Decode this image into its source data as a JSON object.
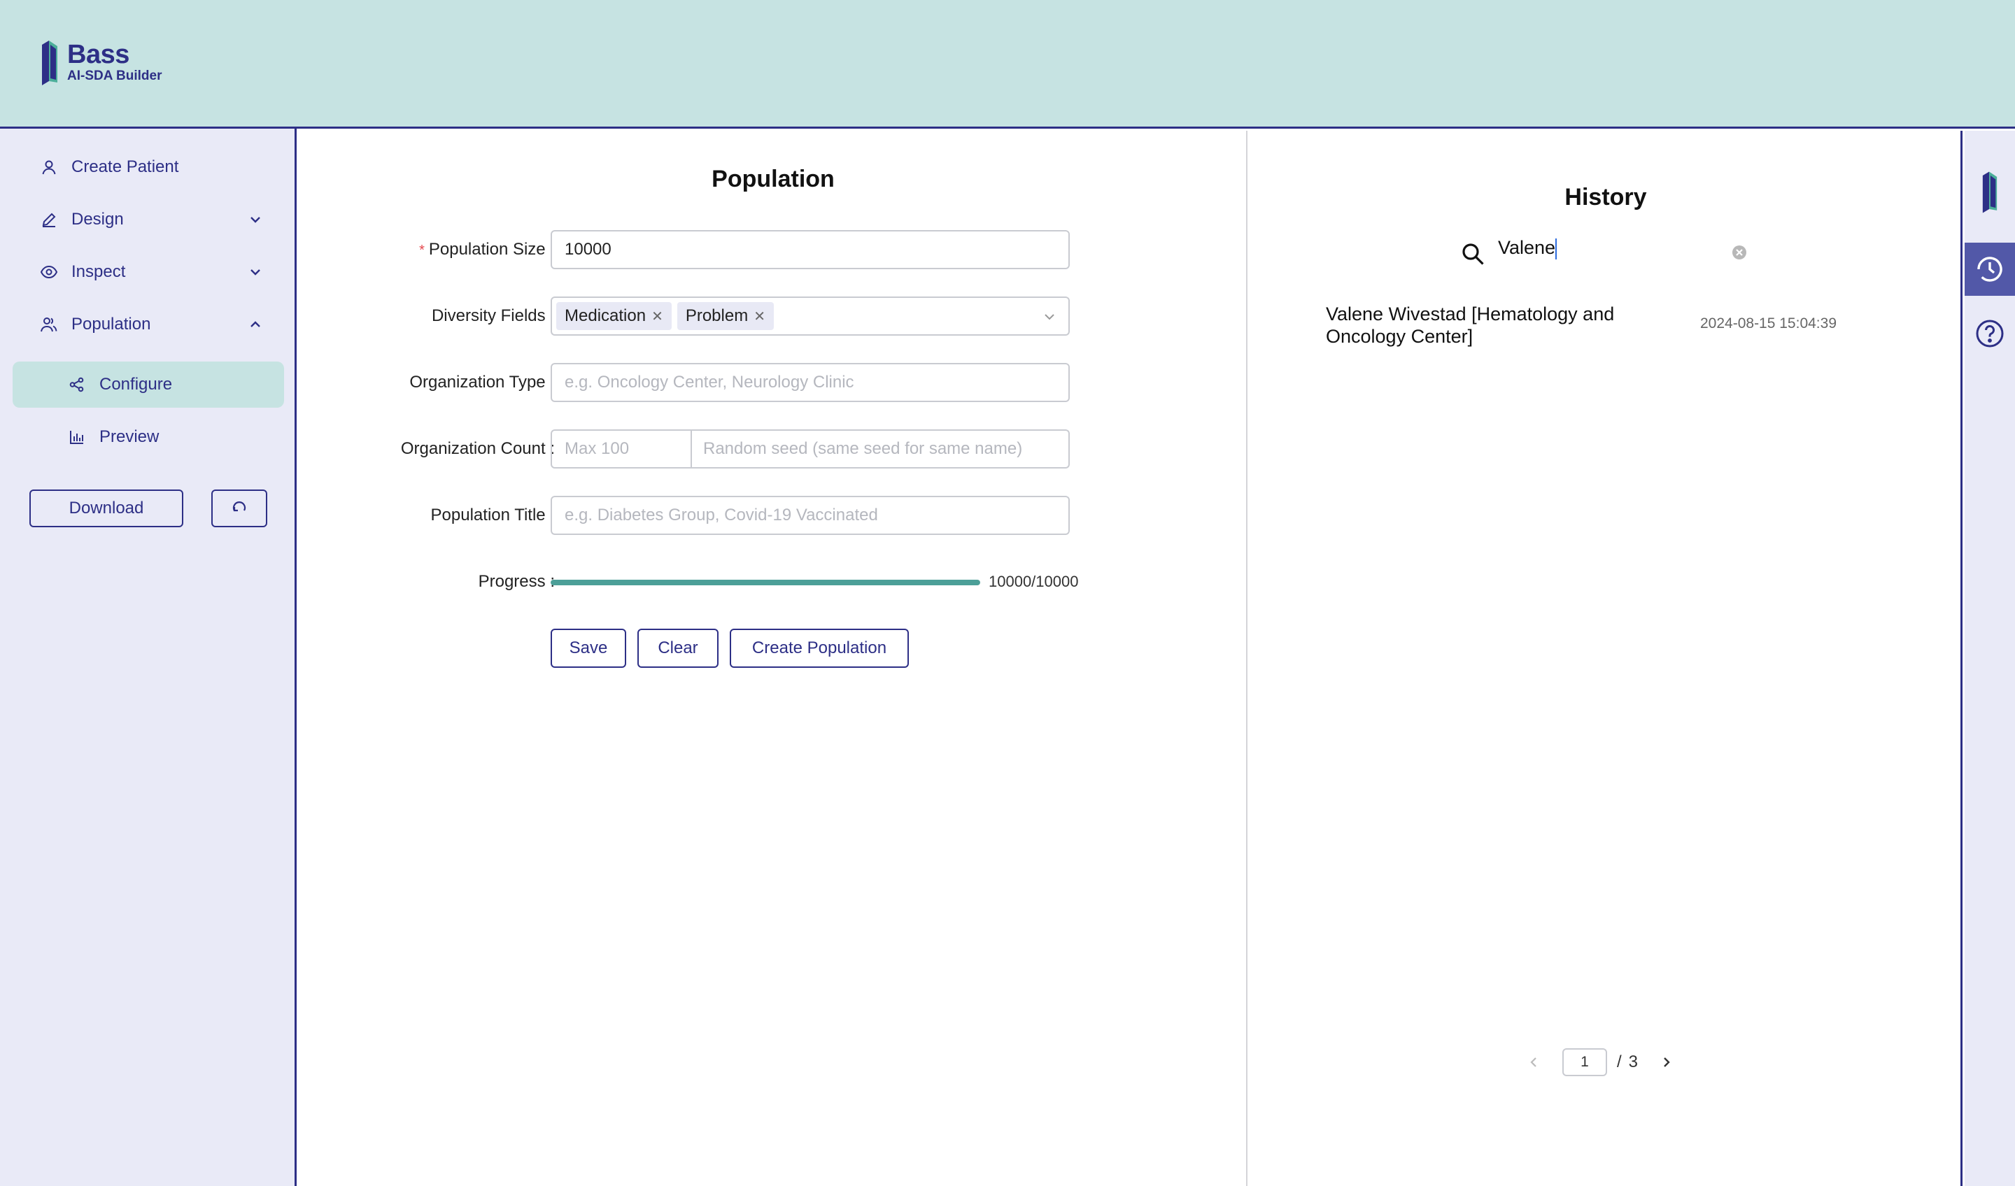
{
  "header": {
    "brand_title": "Bass",
    "brand_subtitle": "AI-SDA Builder",
    "logo_icon": "bass-logo-icon"
  },
  "sidebar": {
    "items": [
      {
        "label": "Create Patient",
        "icon": "user-icon"
      },
      {
        "label": "Design",
        "icon": "pencil-icon",
        "expanded": false
      },
      {
        "label": "Inspect",
        "icon": "eye-icon",
        "expanded": false
      },
      {
        "label": "Population",
        "icon": "users-icon",
        "expanded": true
      },
      {
        "label": "Configure",
        "icon": "share-icon",
        "active": true
      },
      {
        "label": "Preview",
        "icon": "bar-chart-icon"
      }
    ],
    "download_label": "Download",
    "refresh_icon": "refresh-icon"
  },
  "main": {
    "title": "Population",
    "population_size": {
      "label": "Population Size",
      "value": "10000",
      "required": true
    },
    "diversity_fields": {
      "label": "Diversity Fields",
      "tags": [
        "Medication",
        "Problem"
      ]
    },
    "organization_type": {
      "label": "Organization Type",
      "placeholder": "e.g. Oncology Center, Neurology Clinic"
    },
    "organization_count": {
      "label": "Organization Count",
      "placeholder_max": "Max 100",
      "placeholder_seed": "Random seed (same seed for same name)"
    },
    "population_title": {
      "label": "Population Title",
      "placeholder": "e.g. Diabetes Group, Covid-19 Vaccinated"
    },
    "progress": {
      "label": "Progress",
      "text": "10000/10000",
      "fraction": 1.0
    },
    "buttons": {
      "save": "Save",
      "clear": "Clear",
      "create": "Create Population"
    }
  },
  "history": {
    "title": "History",
    "search_value": "Valene",
    "items": [
      {
        "name": "Valene Wivestad [Hematology and Oncology Center]",
        "date": "2024-08-15 15:04:39"
      }
    ],
    "pager": {
      "current": "1",
      "separator": "/",
      "total": "3"
    }
  },
  "rail": {
    "items": [
      "bass-logo-icon",
      "history-icon",
      "help-icon"
    ],
    "active": "history-icon"
  },
  "colors": {
    "header_bg": "#c6e3e2",
    "sidebar_bg": "#e9eaf7",
    "brand": "#2d2f86",
    "progress": "#4c9f98",
    "accent": "#4caf9a"
  }
}
